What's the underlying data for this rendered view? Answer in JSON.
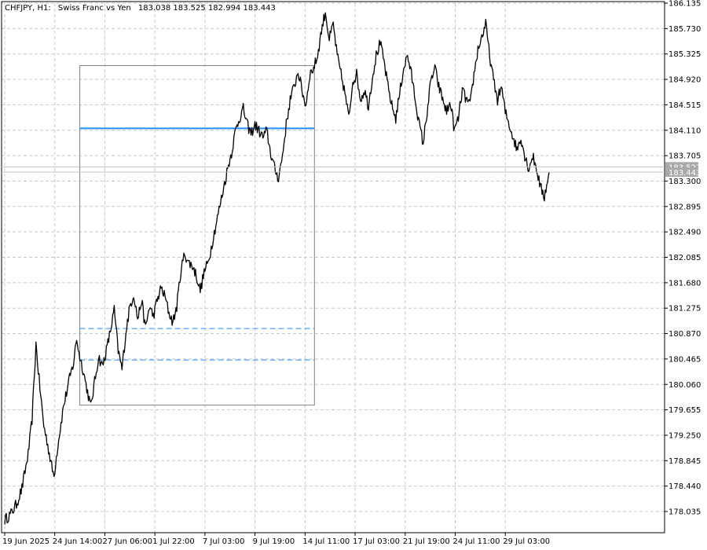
{
  "header": {
    "symbol": "CHFJPY, H1:",
    "description": "Swiss Franc vs Yen",
    "ohlc": "183.038 183.525 182.994 183.443"
  },
  "colors": {
    "background": "#ffffff",
    "grid": "#c8c8c8",
    "price_line": "#000000",
    "level_line": "#1e90ff",
    "box": "#808080",
    "price_tag": "#a9a9a9"
  },
  "chart_data": {
    "type": "line",
    "symbol": "CHFJPY",
    "timeframe": "H1",
    "title": "CHFJPY, H1:  Swiss Franc vs Yen  183.038 183.525 182.994 183.443",
    "grid": true,
    "ylim": [
      177.9,
      186.135
    ],
    "y_ticks": [
      "186.135",
      "185.730",
      "185.325",
      "184.920",
      "184.515",
      "184.110",
      "183.705",
      "183.300",
      "182.895",
      "182.490",
      "182.085",
      "181.680",
      "181.275",
      "180.870",
      "180.465",
      "180.060",
      "179.655",
      "179.250",
      "178.845",
      "178.440",
      "178.035"
    ],
    "x_ticks": [
      "19 Jun 2025",
      "24 Jun 14:00",
      "27 Jun 06:00",
      "1 Jul 22:00",
      "7 Jul 03:00",
      "9 Jul 19:00",
      "14 Jul 11:00",
      "17 Jul 03:00",
      "21 Jul 19:00",
      "24 Jul 11:00",
      "29 Jul 03:00"
    ],
    "x_index_range": [
      0,
      690
    ],
    "x_tick_index": [
      0,
      64,
      128,
      192,
      256,
      320,
      384,
      448,
      512,
      576,
      640
    ],
    "current_price_tags": [
      "183.527",
      "183.443"
    ],
    "series": [
      {
        "values_x": [
          0,
          8,
          15,
          22,
          30,
          35,
          40,
          45,
          50,
          55,
          60,
          63,
          68,
          75,
          82,
          88,
          92,
          95,
          100,
          105,
          110,
          115,
          120,
          125,
          130,
          135,
          140,
          145,
          150,
          155,
          160,
          165,
          170,
          175,
          180,
          185,
          190,
          195,
          200,
          205,
          210,
          215,
          220,
          225,
          230,
          235,
          240,
          245,
          250,
          255,
          260,
          265,
          270,
          275,
          280,
          285,
          290,
          295,
          300,
          305,
          310,
          315,
          320,
          325,
          330,
          335,
          340,
          345,
          350,
          355,
          360,
          365,
          370,
          375,
          380,
          385,
          390,
          395,
          400,
          405,
          410,
          415,
          420,
          425,
          430,
          435,
          440,
          445,
          450,
          455,
          460,
          465,
          470,
          475,
          480,
          485,
          490,
          495,
          500,
          505,
          510,
          515,
          520,
          525,
          530,
          535,
          540,
          545,
          550,
          555,
          560,
          565,
          570,
          575,
          580,
          585,
          590,
          595,
          600,
          605,
          610,
          615,
          620,
          625,
          630,
          635,
          640,
          645,
          650,
          655,
          660,
          665,
          670,
          675,
          680,
          685,
          690,
          693,
          696
        ],
        "values_y": [
          177.9,
          178.0,
          178.15,
          178.4,
          178.95,
          179.5,
          180.7,
          180.0,
          179.4,
          179.1,
          178.75,
          178.6,
          179.1,
          179.7,
          180.1,
          180.4,
          180.8,
          180.55,
          180.3,
          180.0,
          179.7,
          180.1,
          180.5,
          180.35,
          180.6,
          180.9,
          181.25,
          180.6,
          180.3,
          180.9,
          181.3,
          181.5,
          181.1,
          181.4,
          180.95,
          181.3,
          181.15,
          181.4,
          181.6,
          181.45,
          181.2,
          181.05,
          181.3,
          181.85,
          182.15,
          182.0,
          181.95,
          181.8,
          181.55,
          181.85,
          182.0,
          182.3,
          182.6,
          182.9,
          183.2,
          183.5,
          183.75,
          184.1,
          184.3,
          184.45,
          184.2,
          184.05,
          184.2,
          184.1,
          184.0,
          184.1,
          183.75,
          183.5,
          183.35,
          183.7,
          184.2,
          184.6,
          184.8,
          185.05,
          184.75,
          184.5,
          185.0,
          185.1,
          185.3,
          185.7,
          186.0,
          185.55,
          185.8,
          185.3,
          185.0,
          184.7,
          184.3,
          184.9,
          185.0,
          184.6,
          184.75,
          184.5,
          184.95,
          185.3,
          185.5,
          185.2,
          184.8,
          184.5,
          184.3,
          184.7,
          185.1,
          185.3,
          185.0,
          184.6,
          184.2,
          183.9,
          184.4,
          184.9,
          185.1,
          184.8,
          184.6,
          184.4,
          184.55,
          184.1,
          184.3,
          184.75,
          184.6,
          184.5,
          185.0,
          185.4,
          185.6,
          185.8,
          185.3,
          184.9,
          184.6,
          184.8,
          184.4,
          184.2,
          184.0,
          183.8,
          184.0,
          183.7,
          183.5,
          183.7,
          183.5,
          183.2,
          183.05,
          183.25,
          183.44
        ]
      }
    ],
    "annotations": {
      "box": {
        "x_index": [
          96,
          396
        ],
        "y_range": [
          179.73,
          185.14
        ]
      },
      "solid_level": {
        "x_index": [
          96,
          396
        ],
        "y": 184.14
      },
      "dashed_levels": [
        {
          "x_index": [
            96,
            396
          ],
          "y": 180.95
        },
        {
          "x_index": [
            96,
            396
          ],
          "y": 180.45
        }
      ]
    }
  }
}
